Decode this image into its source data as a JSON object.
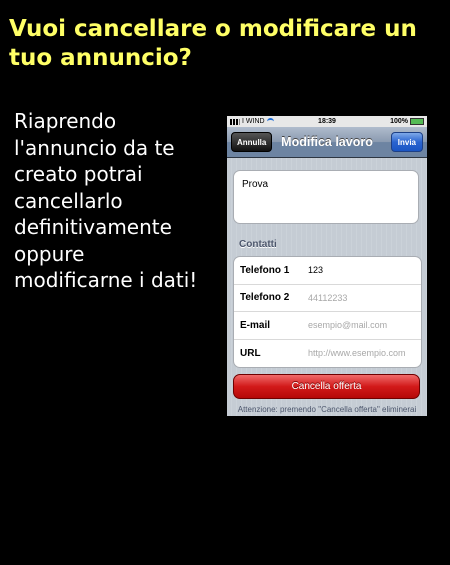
{
  "headline": "Vuoi cancellare o modificare un tuo annuncio?",
  "body": "Riaprendo l'annuncio da te creato potrai cancellarlo definitivamente oppure modificarne i dati!",
  "phone": {
    "status": {
      "carrier": "I WIND",
      "time": "18:39",
      "battery": "100%"
    },
    "navbar": {
      "cancel_label": "Annulla",
      "title": "Modifica lavoro",
      "send_label": "Invia"
    },
    "description_value": "Prova",
    "contacts_label": "Contatti",
    "fields": [
      {
        "label": "Telefono 1",
        "value": "123",
        "placeholder": ""
      },
      {
        "label": "Telefono 2",
        "value": "",
        "placeholder": "44112233"
      },
      {
        "label": "E-mail",
        "value": "",
        "placeholder": "esempio@mail.com"
      },
      {
        "label": "URL",
        "value": "",
        "placeholder": "http://www.esempio.com"
      }
    ],
    "delete_label": "Cancella offerta",
    "warning": "Attenzione: premendo \"Cancella offerta\" eliminerai definitivamente la tua"
  }
}
